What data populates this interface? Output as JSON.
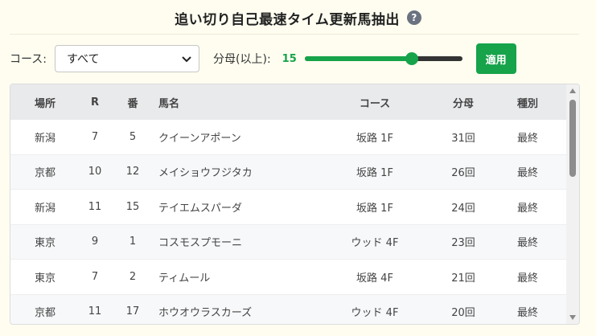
{
  "header": {
    "title": "追い切り自己最速タイム更新馬抽出",
    "help_icon": "?"
  },
  "filters": {
    "course_label": "コース:",
    "course_selected": "すべて",
    "denominator_label": "分母(以上):",
    "denominator_value": "15",
    "denominator_slider_fraction": 0.68,
    "apply_label": "適用"
  },
  "colors": {
    "accent": "#16a34a",
    "background": "#fefdf0",
    "header_bg": "#e9eaec"
  },
  "table": {
    "columns": {
      "place": "場所",
      "race": "R",
      "number": "番",
      "horse": "馬名",
      "course": "コース",
      "denominator": "分母",
      "kind": "種別"
    },
    "rows": [
      {
        "place": "新潟",
        "race": "7",
        "number": "5",
        "horse": "クイーンアポーン",
        "course": "坂路 1F",
        "denominator": "31回",
        "kind": "最終"
      },
      {
        "place": "京都",
        "race": "10",
        "number": "12",
        "horse": "メイショウフジタカ",
        "course": "坂路 1F",
        "denominator": "26回",
        "kind": "最終"
      },
      {
        "place": "新潟",
        "race": "11",
        "number": "15",
        "horse": "テイエムスパーダ",
        "course": "坂路 1F",
        "denominator": "24回",
        "kind": "最終"
      },
      {
        "place": "東京",
        "race": "9",
        "number": "1",
        "horse": "コスモスプモーニ",
        "course": "ウッド 4F",
        "denominator": "23回",
        "kind": "最終"
      },
      {
        "place": "東京",
        "race": "7",
        "number": "2",
        "horse": "ティムール",
        "course": "坂路 4F",
        "denominator": "21回",
        "kind": "最終"
      },
      {
        "place": "京都",
        "race": "11",
        "number": "17",
        "horse": "ホウオウラスカーズ",
        "course": "ウッド 4F",
        "denominator": "20回",
        "kind": "最終"
      }
    ]
  }
}
